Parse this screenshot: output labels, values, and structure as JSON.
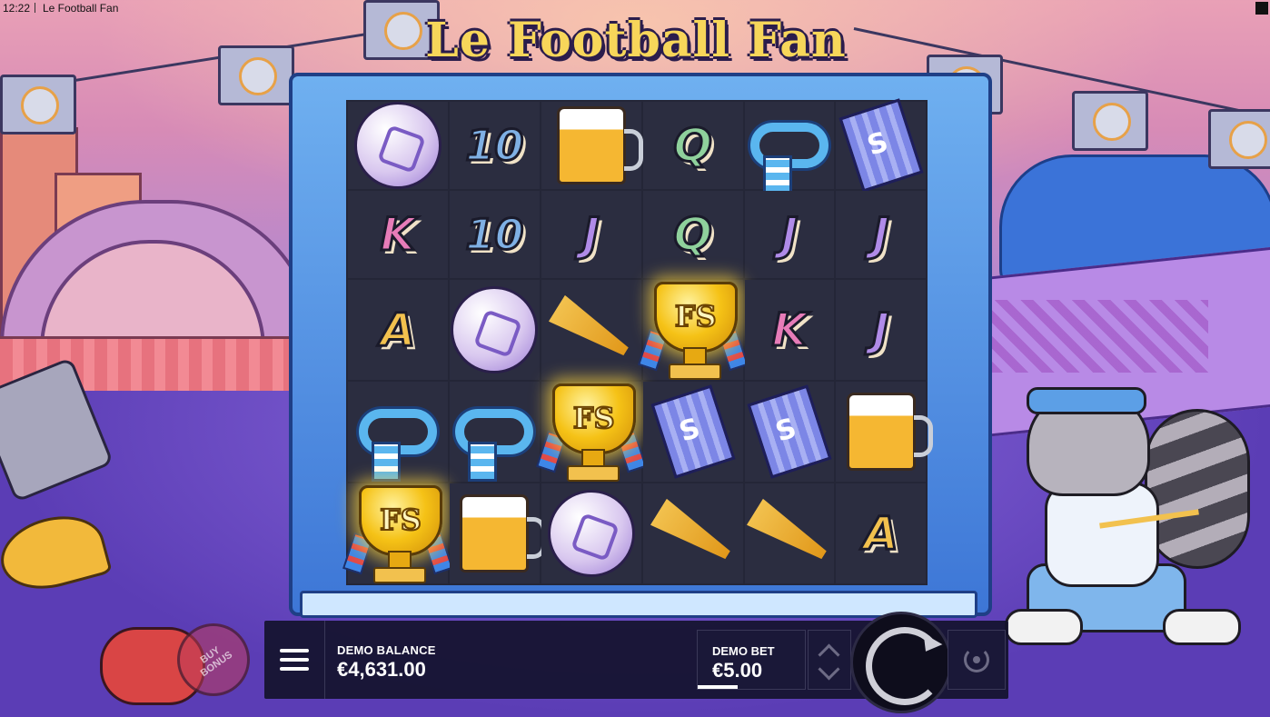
{
  "status": {
    "time": "12:22",
    "app_title": "Le Football Fan"
  },
  "game": {
    "title": "Le Football Fan"
  },
  "reels": [
    [
      "ball",
      "10",
      "beer",
      "Q",
      "scarf",
      "ticket"
    ],
    [
      "K",
      "10",
      "J",
      "Q",
      "J",
      "J"
    ],
    [
      "A",
      "ball",
      "horn",
      "trophy",
      "K",
      "J"
    ],
    [
      "scarf",
      "scarf",
      "trophy",
      "ticket",
      "ticket",
      "beer"
    ],
    [
      "trophy",
      "beer",
      "ball",
      "horn",
      "horn",
      "A"
    ]
  ],
  "trophy_label": "FS",
  "buy_bonus": {
    "line1": "BUY",
    "line2": "BONUS"
  },
  "hud": {
    "balance_label": "DEMO BALANCE",
    "balance_value": "€4,631.00",
    "bet_label": "DEMO BET",
    "bet_value": "€5.00"
  },
  "icons": {
    "menu": "hamburger-icon",
    "bet_up": "chevron-up-icon",
    "bet_down": "chevron-down-icon",
    "spin": "spin-arrow-icon",
    "autoplay": "autoplay-icon"
  },
  "colors": {
    "hud_bg": "#14122c",
    "frame": "#3d76d6",
    "reel_bg": "#2b2d40",
    "title": "#f7d65a"
  }
}
